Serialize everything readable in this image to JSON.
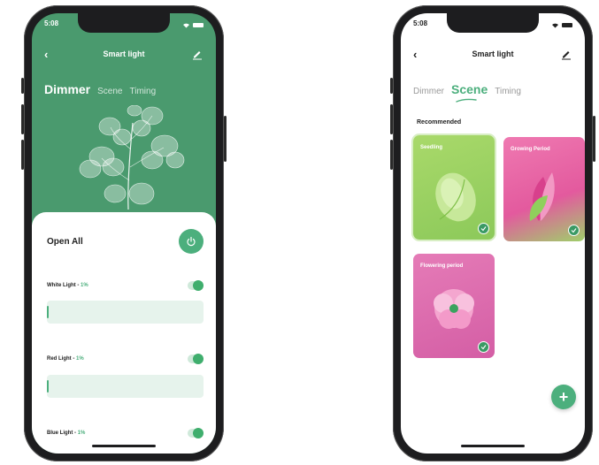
{
  "colors": {
    "accent": "#4caf7d",
    "header_green": "#4a9a6e",
    "panel_bg": "#ffffff",
    "slider_bg": "#e6f3ec"
  },
  "dimmer_screen": {
    "status_time": "5:08",
    "title": "Smart light",
    "tabs": [
      {
        "label": "Dimmer",
        "active": true
      },
      {
        "label": "Scene",
        "active": false
      },
      {
        "label": "Timing",
        "active": false
      }
    ],
    "open_all_label": "Open All",
    "lights": [
      {
        "name": "White Light",
        "sep": " - ",
        "percent": "1%",
        "level": 0.01,
        "on": true
      },
      {
        "name": "Red Light",
        "sep": " - ",
        "percent": "1%",
        "level": 0.01,
        "on": true
      },
      {
        "name": "Blue Light",
        "sep": " - ",
        "percent": "1%",
        "level": 0.01,
        "on": true
      }
    ]
  },
  "scene_screen": {
    "status_time": "5:08",
    "title": "Smart light",
    "tabs": [
      {
        "label": "Dimmer",
        "active": false
      },
      {
        "label": "Scene",
        "active": true
      },
      {
        "label": "Timing",
        "active": false
      }
    ],
    "section_label": "Recommended",
    "cards": [
      {
        "title": "Seedling",
        "color": "#9ed15f",
        "selected": true
      },
      {
        "title": "Growing Period",
        "color": "#e86aa8",
        "selected": true
      },
      {
        "title": "Flowering period",
        "color": "#e27ab6",
        "selected": true
      }
    ],
    "fab_label": "+"
  }
}
